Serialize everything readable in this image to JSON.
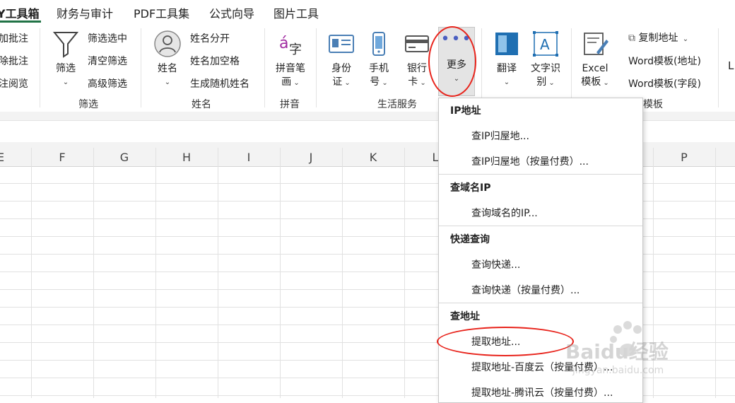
{
  "tabs": [
    "Y工具箱",
    "财务与审计",
    "PDF工具集",
    "公式向导",
    "图片工具"
  ],
  "ribbon": {
    "comments": [
      "加批注",
      "除批注",
      "注阅览"
    ],
    "filter": {
      "big_label": "筛选",
      "items": [
        "筛选选中",
        "清空筛选",
        "高级筛选"
      ],
      "group_label": "筛选"
    },
    "name": {
      "big_label": "姓名",
      "items": [
        "姓名分开",
        "姓名加空格",
        "生成随机姓名"
      ],
      "group_label": "姓名"
    },
    "pinyin": {
      "big_label_line1": "拼音笔",
      "big_label_line2": "画",
      "group_label": "拼音"
    },
    "life": {
      "id_line1": "身份",
      "id_line2": "证",
      "phone_line1": "手机",
      "phone_line2": "号",
      "bank_line1": "银行",
      "bank_line2": "卡",
      "more_label": "更多",
      "group_label": "生活服务"
    },
    "translate": {
      "translate_label": "翻译",
      "ocr_line1": "文字识",
      "ocr_line2": "别"
    },
    "template": {
      "excel_line1": "Excel",
      "excel_line2": "模板",
      "copy_addr": "复制地址",
      "word_addr": "Word模板(地址)",
      "word_field": "Word模板(字段)",
      "group_label": "模板",
      "extra": "L"
    }
  },
  "columns": [
    "E",
    "F",
    "G",
    "H",
    "I",
    "J",
    "K",
    "L",
    "P"
  ],
  "menu": {
    "sections": [
      {
        "title": "IP地址",
        "items": [
          "查IP归屋地...",
          "查IP归屋地（按量付费）..."
        ]
      },
      {
        "title": "查域名IP",
        "items": [
          "查询域名的IP..."
        ]
      },
      {
        "title": "快递查询",
        "items": [
          "查询快递...",
          "查询快递（按量付费）..."
        ]
      },
      {
        "title": "查地址",
        "items": [
          "提取地址...",
          "提取地址-百度云（按量付费）...",
          "提取地址-腾讯云（按量付费）..."
        ]
      }
    ]
  },
  "watermark": {
    "brand": "Baidu经验",
    "url": "jingyan.baidu.com"
  },
  "colors": {
    "accent": "#217346",
    "annotation": "#e8241c"
  }
}
